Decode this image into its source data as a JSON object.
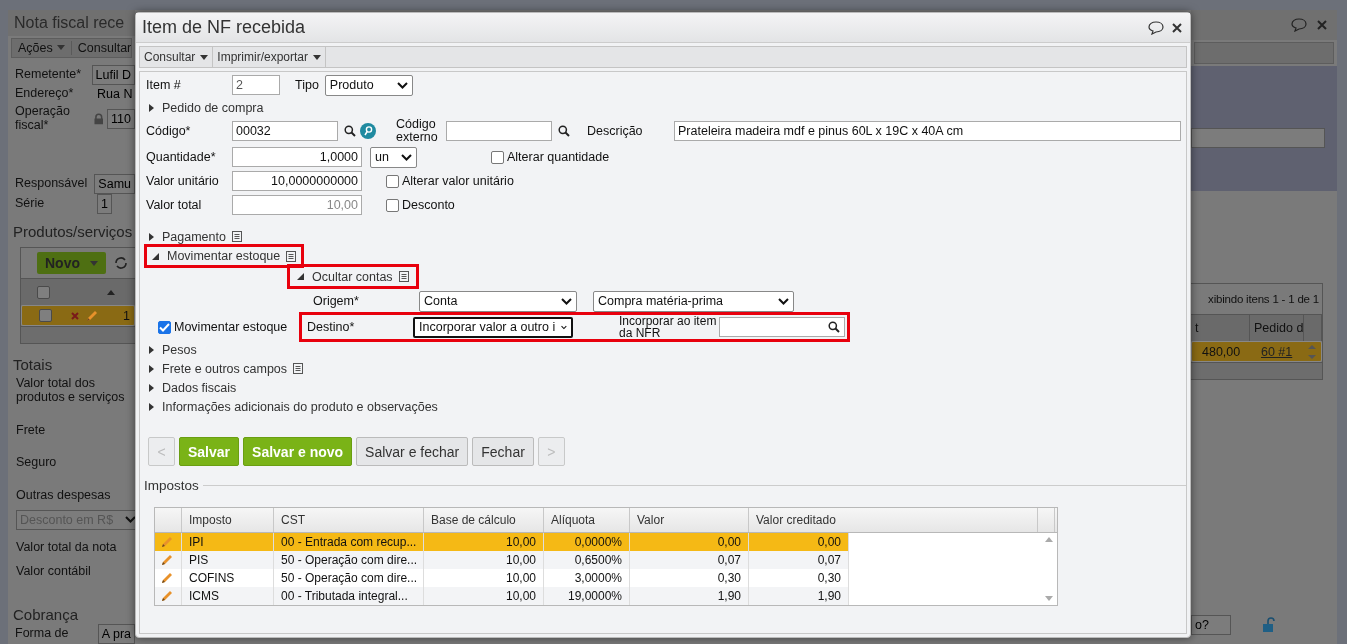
{
  "background": {
    "title": "Nota fiscal rece",
    "menu": [
      "Ações",
      "Consultar"
    ],
    "fields": [
      {
        "label": "Remetente*",
        "value": "Lufil D",
        "kind": "input"
      },
      {
        "label": "Endereço*",
        "value": "Rua N",
        "kind": "text"
      },
      {
        "label": "Operação fiscal*",
        "value": "110",
        "kind": "locked"
      }
    ],
    "fields_2": [
      {
        "label": "Responsável",
        "value": "Samu",
        "kind": "input"
      },
      {
        "label": "Série",
        "value": "1",
        "kind": "input"
      }
    ],
    "products": {
      "title": "Produtos/serviços",
      "new_button": "Novo",
      "all_checked": false,
      "paging": "xibindo itens 1 - 1 de 1",
      "columns": [
        "t",
        "Pedido d"
      ],
      "row": {
        "selected": true,
        "checked": false,
        "number": "1",
        "total": "480,00",
        "order_link": "60 #1"
      }
    },
    "totals": {
      "title": "Totais",
      "labels": [
        "Valor total dos produtos e serviços",
        "Frete",
        "Seguro",
        "Outras despesas"
      ],
      "discount_select": "Desconto em R$",
      "labels_2": [
        "Valor total da nota",
        "Valor contábil"
      ]
    },
    "billing": {
      "title": "Cobrança",
      "label": "Forma de",
      "value": "A pra"
    },
    "footer_field": "o?"
  },
  "dialog": {
    "title": "Item de NF recebida",
    "menu": [
      "Consultar",
      "Imprimir/exportar"
    ],
    "item_number": {
      "label": "Item #",
      "value": "2"
    },
    "type": {
      "label": "Tipo",
      "value": "Produto"
    },
    "purchase_order": {
      "label": "Pedido de compra",
      "expanded": false
    },
    "code": {
      "label": "Código*",
      "value": "00032"
    },
    "external_code": {
      "label": "Código externo"
    },
    "description": {
      "label": "Descrição",
      "value": "Prateleira madeira mdf e pinus 60L x 19C x 40A cm"
    },
    "quantity": {
      "label": "Quantidade*",
      "value": "1,0000",
      "unit": "un",
      "option": {
        "label": "Alterar quantidade",
        "checked": false
      }
    },
    "unit_value": {
      "label": "Valor unitário",
      "value": "10,0000000000",
      "option": {
        "label": "Alterar valor unitário",
        "checked": false
      }
    },
    "total_value": {
      "label": "Valor total",
      "value": "10,00",
      "disabled": true,
      "option": {
        "label": "Desconto",
        "checked": false
      }
    },
    "payment": {
      "label": "Pagamento",
      "expanded": false
    },
    "stock": {
      "label": "Movimentar estoque",
      "expanded": true,
      "highlighted": true,
      "accounts": {
        "label": "Ocultar contas",
        "expanded": true,
        "highlighted": true
      },
      "move_stock": {
        "label": "Movimentar estoque",
        "checked": true
      },
      "origin": {
        "label": "Origem*",
        "value": "Conta",
        "account": "Compra matéria-prima"
      },
      "destination": {
        "label": "Destino*",
        "value": "Incorporar valor a outro i",
        "focused": true,
        "highlighted": true,
        "incorporate_label": "Incorporar ao item da NFR"
      }
    },
    "sections": [
      {
        "label": "Pesos",
        "expanded": false,
        "notes": false
      },
      {
        "label": "Frete e outros campos",
        "expanded": false,
        "notes": true
      },
      {
        "label": "Dados fiscais",
        "expanded": false,
        "notes": false
      },
      {
        "label": "Informações adicionais do produto e observações",
        "expanded": false,
        "notes": false
      }
    ],
    "buttons": [
      {
        "label": "<",
        "kind": "nav",
        "disabled": true
      },
      {
        "label": "Salvar",
        "kind": "primary",
        "disabled": false
      },
      {
        "label": "Salvar e novo",
        "kind": "primary",
        "disabled": false
      },
      {
        "label": "Salvar e fechar",
        "kind": "secondary",
        "disabled": false
      },
      {
        "label": "Fechar",
        "kind": "secondary",
        "disabled": false
      },
      {
        "label": ">",
        "kind": "nav",
        "disabled": true
      }
    ],
    "taxes": {
      "title": "Impostos",
      "columns": [
        "Imposto",
        "CST",
        "Base de cálculo",
        "Alíquota",
        "Valor",
        "Valor creditado"
      ],
      "rows": [
        {
          "selected": true,
          "cells": [
            "IPI",
            "00 - Entrada com recup...",
            "10,00",
            "0,0000%",
            "0,00",
            "0,00"
          ]
        },
        {
          "selected": false,
          "cells": [
            "PIS",
            "50 - Operação com dire...",
            "10,00",
            "0,6500%",
            "0,07",
            "0,07"
          ]
        },
        {
          "selected": false,
          "cells": [
            "COFINS",
            "50 - Operação com dire...",
            "10,00",
            "3,0000%",
            "0,30",
            "0,30"
          ]
        },
        {
          "selected": false,
          "cells": [
            "ICMS",
            "00 - Tributada integral...",
            "10,00",
            "19,0000%",
            "1,90",
            "1,90"
          ]
        }
      ]
    }
  }
}
